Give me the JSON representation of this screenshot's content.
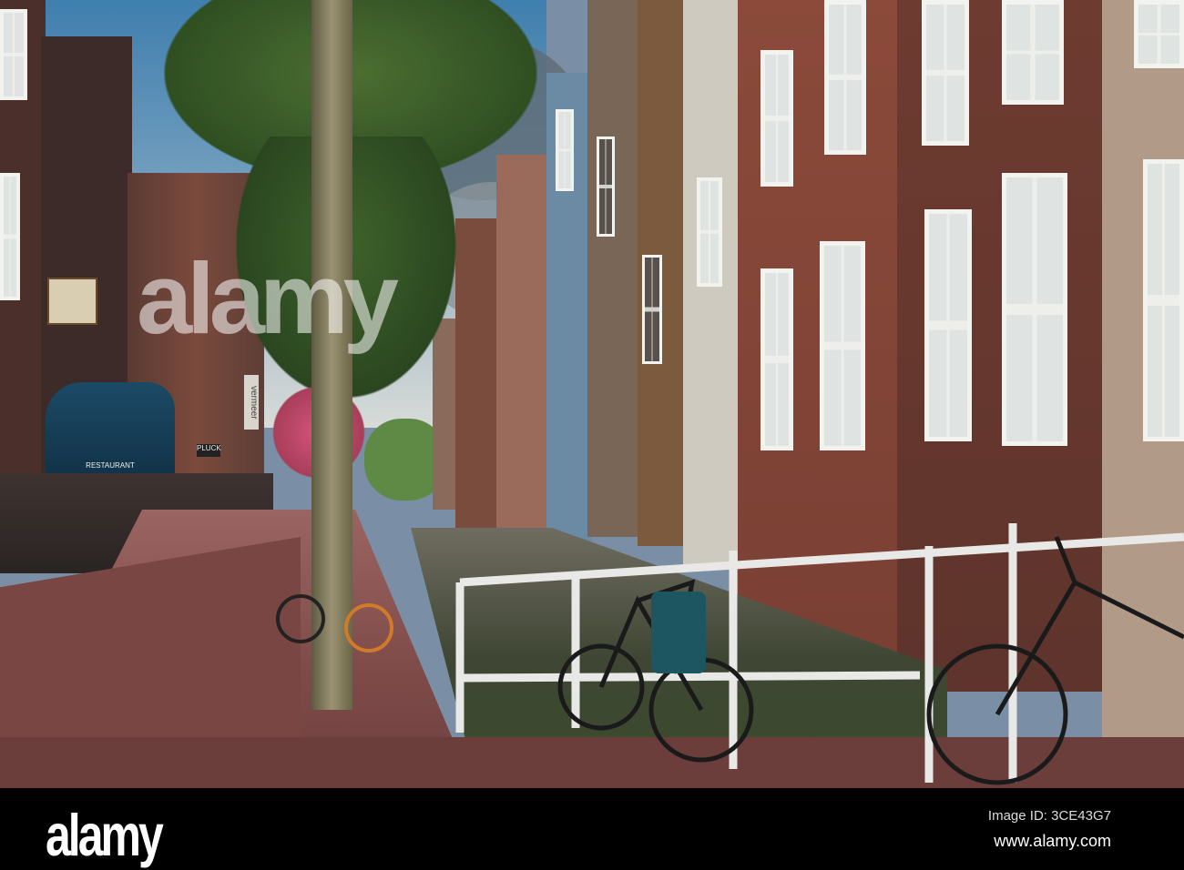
{
  "watermark": {
    "logo": "alamy",
    "image_id": "Image ID: 3CE43G7",
    "site": "www.alamy.com",
    "overlay_text": "alamy"
  },
  "signs": {
    "vermeer": "vermeer",
    "pluck": "PLUCK",
    "restaurant": "RESTAURANT"
  },
  "colors": {
    "sky": "#5f90b6",
    "brick": "#7b3f33",
    "street": "#8a4e4b",
    "awning": "#143f5a",
    "canal": "#4a5140"
  }
}
